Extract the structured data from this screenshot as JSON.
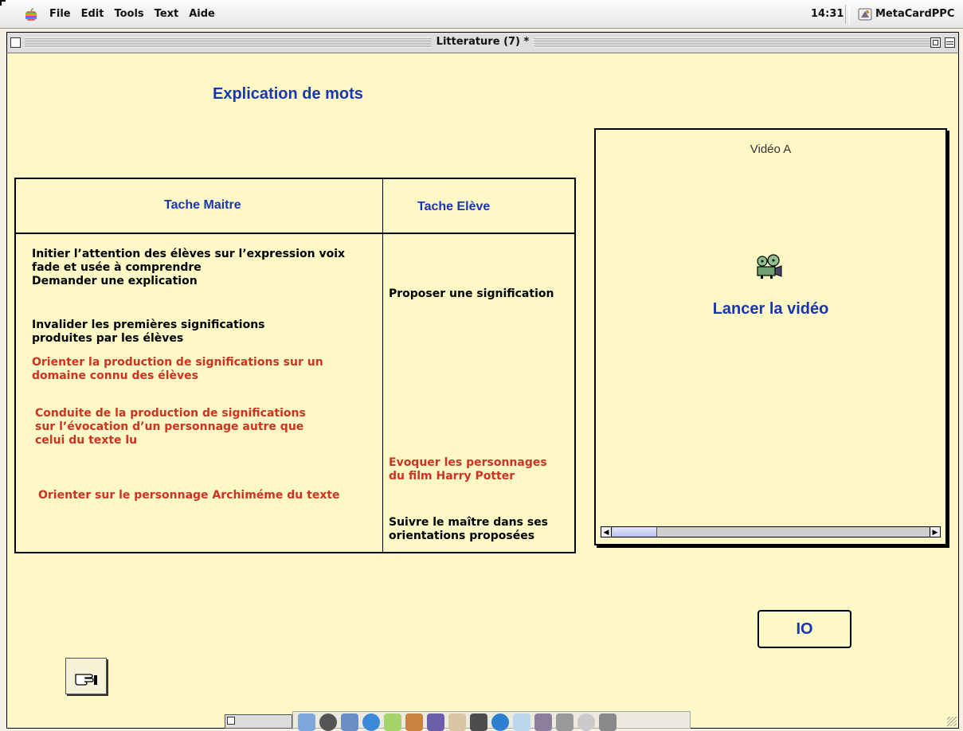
{
  "menubar": {
    "menus": [
      "File",
      "Edit",
      "Tools",
      "Text",
      "Aide"
    ],
    "clock": "14:31",
    "app_name": "MetaCardPPC"
  },
  "window": {
    "title": "Litterature (7) *"
  },
  "page": {
    "heading": "Explication de mots"
  },
  "table": {
    "header_master": "Tache Maitre",
    "header_student": "Tache Elève",
    "master_tasks": [
      {
        "lines": [
          "Initier l’attention des élèves sur l’expression voix",
          "fade et usée à comprendre",
          "Demander une explication"
        ],
        "color": "black"
      },
      {
        "lines": [
          "Invalider les premières significations",
          "produites par les élèves"
        ],
        "color": "black"
      },
      {
        "lines": [
          "Orienter la production de significations sur un",
          "domaine connu des élèves"
        ],
        "color": "red"
      },
      {
        "lines": [
          "Conduite de la production de significations",
          "sur l’évocation d’un personnage autre que",
          "celui du texte lu"
        ],
        "color": "red"
      },
      {
        "lines": [
          "Orienter sur le personnage Archiméme du texte"
        ],
        "color": "red"
      }
    ],
    "student_tasks": [
      {
        "lines": [
          "Proposer une signification"
        ],
        "color": "black"
      },
      {
        "lines": [
          "Evoquer les personnages",
          "du film Harry Potter"
        ],
        "color": "red"
      },
      {
        "lines": [
          "Suivre le maître dans ses",
          "orientations proposées"
        ],
        "color": "black"
      }
    ]
  },
  "video": {
    "title": "Vidéo A",
    "launch_label": "Lancer la vidéo",
    "icon": "film-projector-icon"
  },
  "buttons": {
    "io_label": "IO",
    "hand_icon": "pointing-hand-icon"
  },
  "colors": {
    "background": "#fdf8c6",
    "heading_blue": "#1836b0",
    "task_red": "#cc3322"
  }
}
